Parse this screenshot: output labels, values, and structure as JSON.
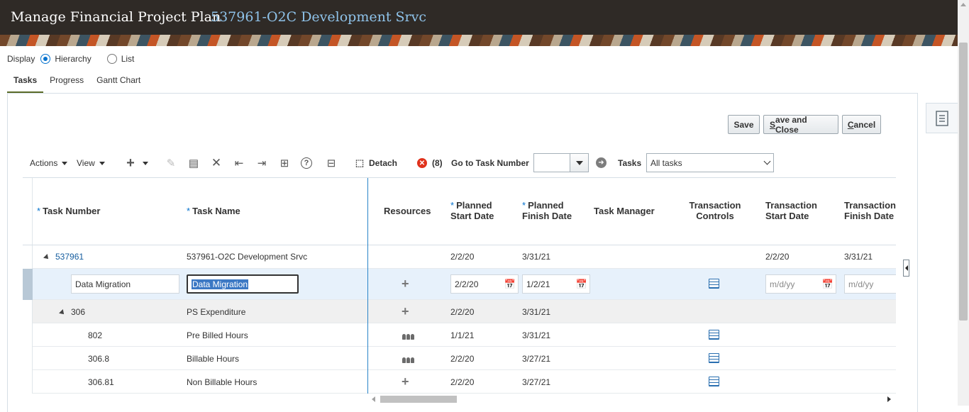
{
  "header": {
    "title": "Manage Financial Project Plan",
    "subtitle": "537961-O2C Development Srvc"
  },
  "display": {
    "label": "Display",
    "options": [
      "Hierarchy",
      "List"
    ],
    "selected": "Hierarchy"
  },
  "tabs": [
    {
      "label": "Tasks",
      "active": true
    },
    {
      "label": "Progress",
      "active": false
    },
    {
      "label": "Gantt Chart",
      "active": false
    }
  ],
  "buttons": {
    "save": "Save",
    "save_and_close_pre": "S",
    "save_and_close_post": "ave and Close",
    "cancel_pre": "C",
    "cancel_post": "ancel"
  },
  "toolbar": {
    "actions": "Actions",
    "view": "View",
    "detach": "Detach",
    "error_count": "(8)",
    "go_to_task_label": "Go to Task Number",
    "go_to_task_value": "",
    "tasks_label": "Tasks",
    "tasks_filter": "All tasks"
  },
  "columns": {
    "task_number": "Task Number",
    "task_name": "Task Name",
    "resources": "Resources",
    "planned_start_1": "Planned",
    "planned_start_2": "Start Date",
    "planned_finish_1": "Planned",
    "planned_finish_2": "Finish Date",
    "task_manager": "Task Manager",
    "transaction_controls_1": "Transaction",
    "transaction_controls_2": "Controls",
    "transaction_start_1": "Transaction",
    "transaction_start_2": "Start Date",
    "transaction_finish_1": "Transaction",
    "transaction_finish_2": "Finish Date",
    "required_marker": "*"
  },
  "rows": [
    {
      "number": "537961",
      "name": "537961-O2C Development Srvc",
      "start": "2/2/20",
      "finish": "3/31/21",
      "txn_start": "2/2/20",
      "txn_finish": "3/31/21"
    },
    {
      "number": "Data Migration",
      "name": "Data Migration",
      "start": "2/2/20",
      "finish": "1/2/21",
      "txn_start_placeholder": "m/d/yy",
      "txn_finish_placeholder": "m/d/yy"
    },
    {
      "number": "306",
      "name": "PS Expenditure",
      "start": "2/2/20",
      "finish": "3/31/21"
    },
    {
      "number": "802",
      "name": "Pre Billed Hours",
      "start": "1/1/21",
      "finish": "3/31/21"
    },
    {
      "number": "306.8",
      "name": "Billable Hours",
      "start": "2/2/20",
      "finish": "3/27/21"
    },
    {
      "number": "306.81",
      "name": "Non Billable Hours",
      "start": "2/2/20",
      "finish": "3/27/21"
    }
  ]
}
